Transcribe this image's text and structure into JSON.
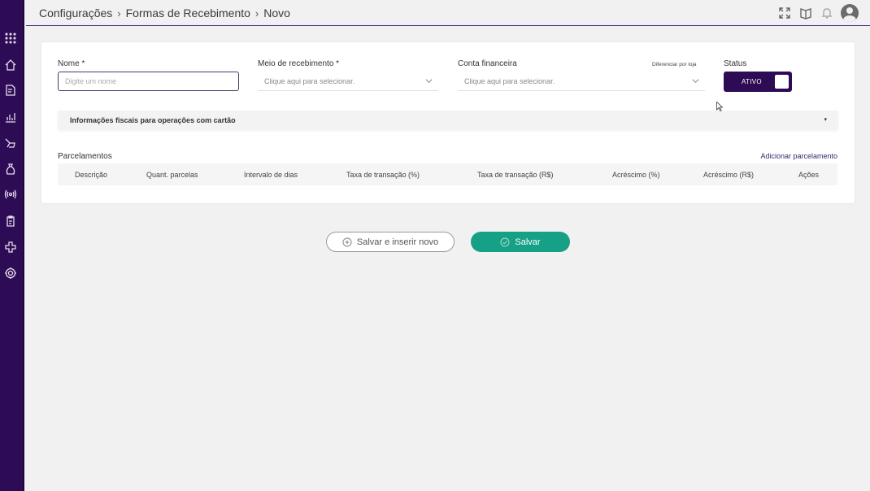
{
  "breadcrumb": {
    "item1": "Configurações",
    "item2": "Formas de Recebimento",
    "item3": "Novo",
    "separator": "›"
  },
  "top_icons": [
    "expand-icon",
    "help-book-icon",
    "bell-icon",
    "user-avatar-icon"
  ],
  "sidebar_icons": [
    "apps-grid-icon",
    "home-icon",
    "document-edit-icon",
    "chart-icon",
    "tools-icon",
    "money-bag-icon",
    "broadcast-icon",
    "clipboard-icon",
    "plus-cross-icon",
    "gear-icon"
  ],
  "form": {
    "nome_label": "Nome *",
    "nome_placeholder": "Digite um nome",
    "meio_label": "Meio de recebimento *",
    "meio_placeholder": "Clique aqui para selecionar.",
    "conta_label": "Conta financeira",
    "conta_placeholder": "Clique aqui para selecionar.",
    "diferenciar_link": "Diferenciar por loja",
    "status_label": "Status",
    "status_value": "ATIVO"
  },
  "fiscal_section": {
    "title": "Informações fiscais para operações com cartão",
    "caret": "▾"
  },
  "parcelamentos": {
    "title": "Parcelamentos",
    "add_link": "Adicionar parcelamento",
    "columns": [
      "Descrição",
      "Quant. parcelas",
      "Intervalo de dias",
      "Taxa de transação (%)",
      "Taxa de transação (R$)",
      "Acréscimo (%)",
      "Acréscimo (R$)",
      "Ações"
    ]
  },
  "actions": {
    "save_new": "Salvar e inserir novo",
    "save": "Salvar"
  },
  "colors": {
    "sidebar": "#2e0b55",
    "accent": "#2e0b55",
    "save_button": "#16a085"
  }
}
